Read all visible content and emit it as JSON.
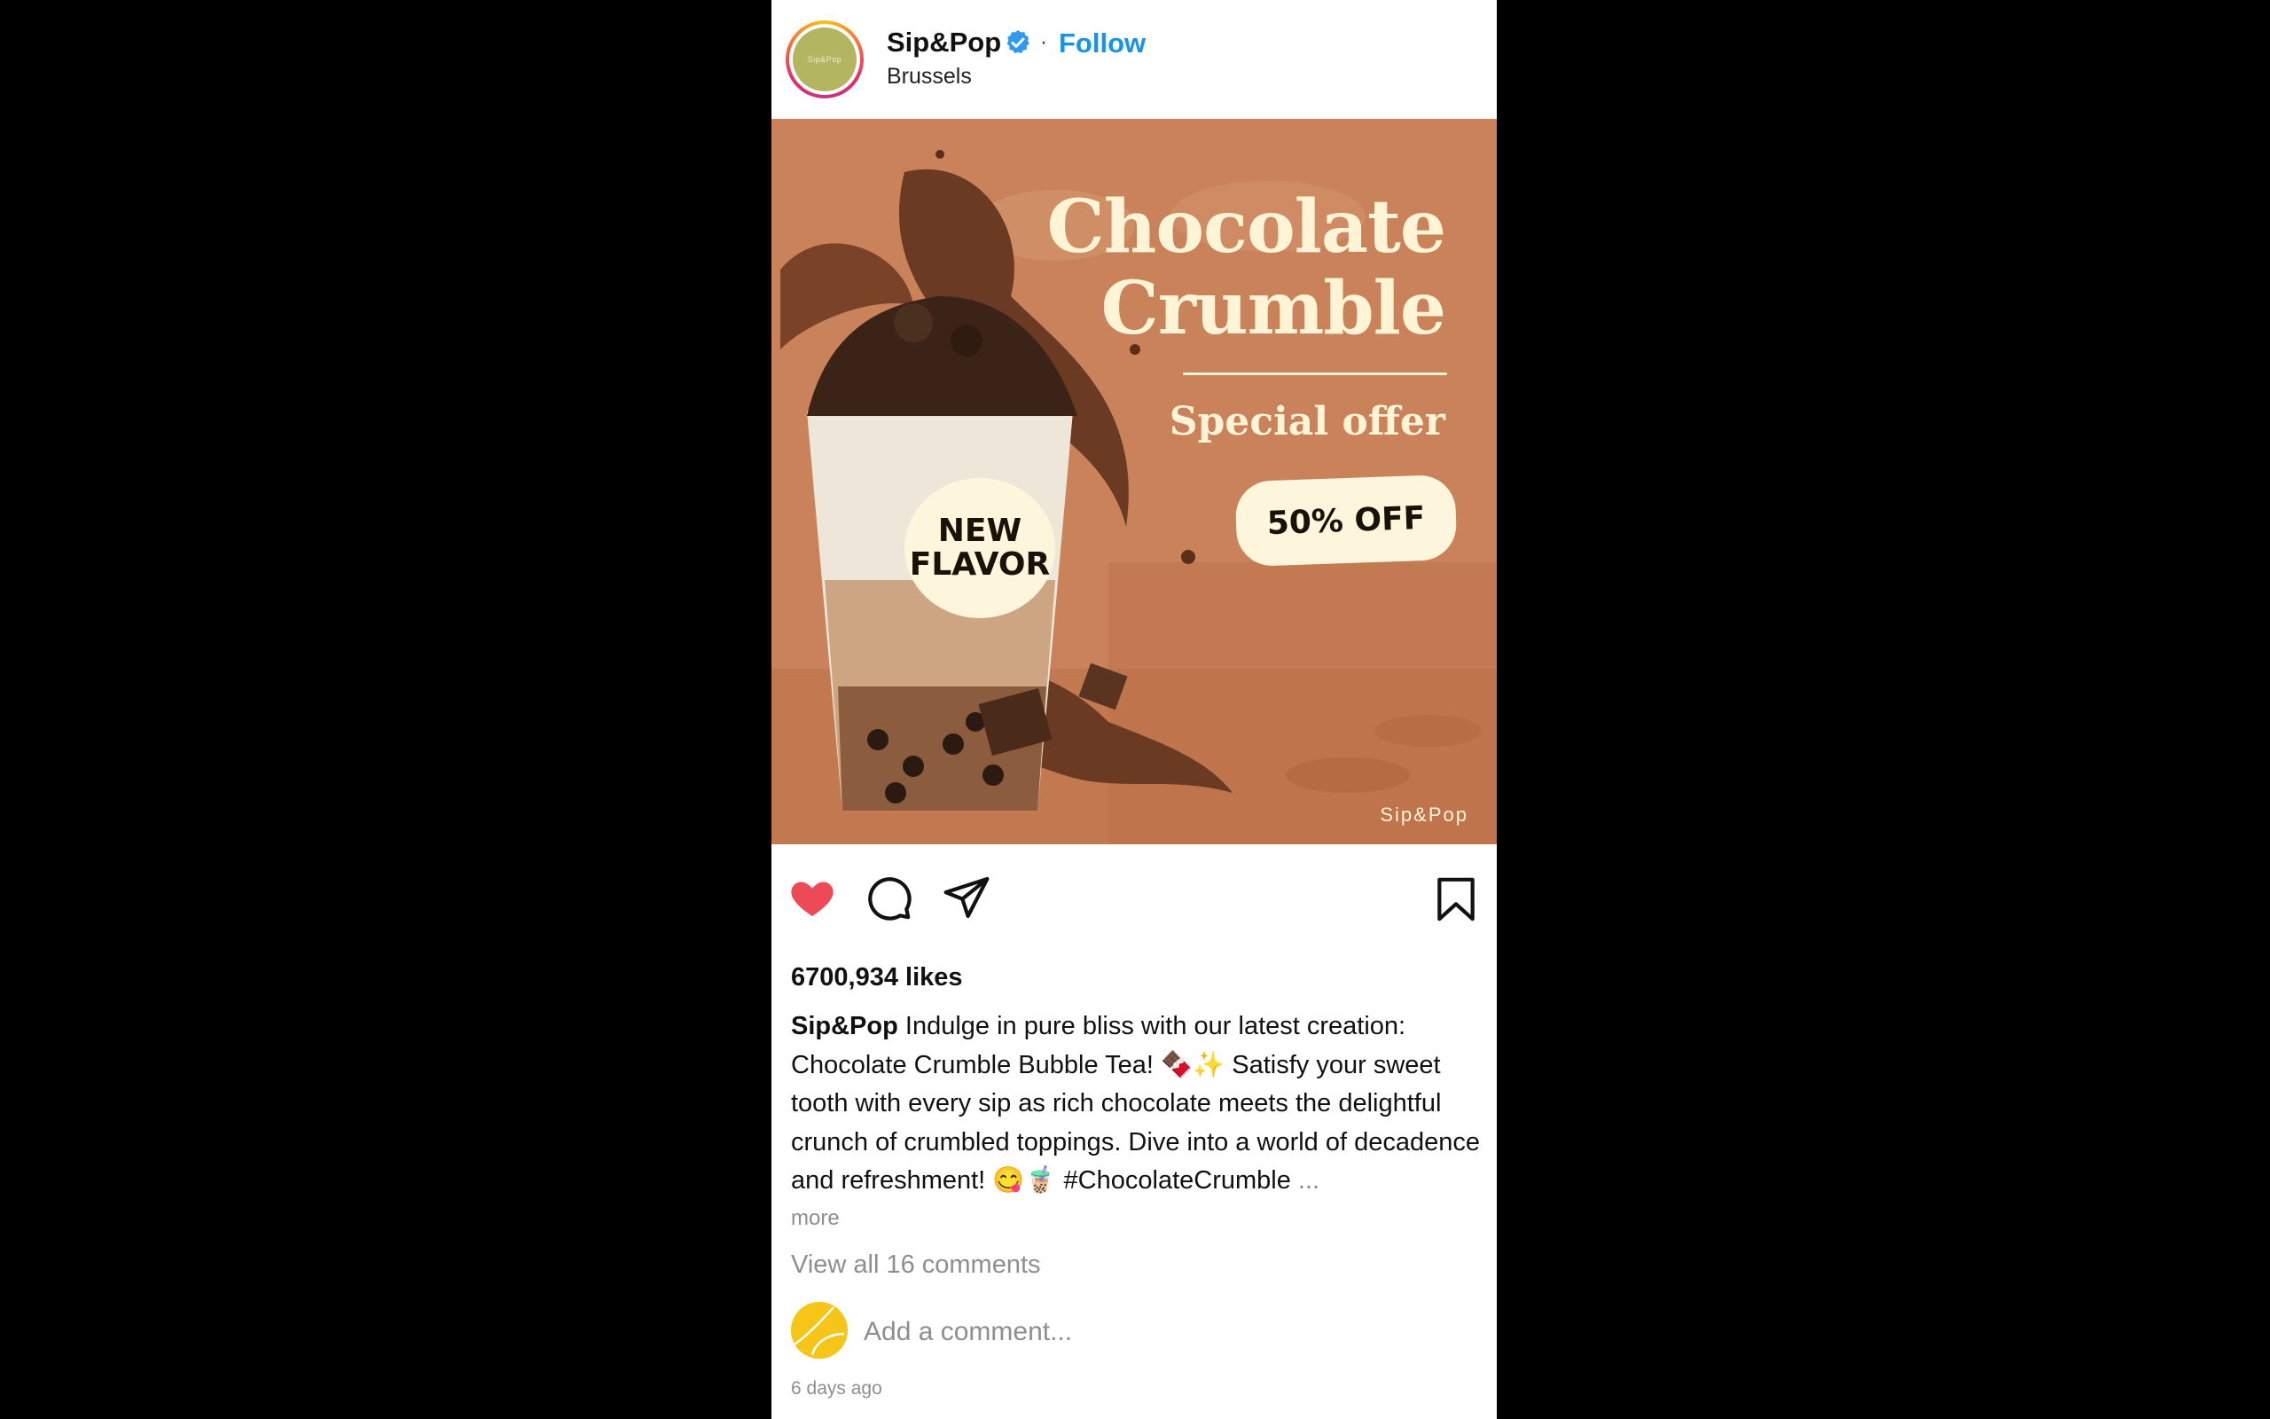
{
  "post": {
    "account": {
      "username": "Sip&Pop",
      "avatar_text": "Sip&Pop",
      "verified_icon": "verified-badge-icon",
      "separator": "·",
      "follow_label": "Follow",
      "location": "Brussels"
    },
    "image": {
      "title": "Chocolate Crumble",
      "subtitle": "Special offer",
      "discount": "50% OFF",
      "badge": "NEW\nFLAVOR",
      "watermark": "Sip&Pop"
    },
    "actions": {
      "like_icon": "heart-filled-icon",
      "comment_icon": "comment-bubble-icon",
      "share_icon": "paper-plane-icon",
      "bookmark_icon": "bookmark-icon",
      "liked": true
    },
    "likes_text": "6700,934 likes",
    "caption": {
      "username": "Sip&Pop",
      "text": "Indulge in pure bliss with our latest creation: Chocolate Crumble Bubble Tea! 🍫✨ Satisfy your sweet tooth with every sip as rich chocolate meets the delightful crunch of crumbled toppings. Dive into a world of decadence and refreshment! 😋🧋 #ChocolateCrumble",
      "ellipsis": "...",
      "more_label": "more"
    },
    "view_comments_label": "View all 16 comments",
    "comment_placeholder": "Add a comment...",
    "timestamp": "6 days ago"
  },
  "colors": {
    "follow": "#1a93e6",
    "like": "#ed4956",
    "hero_background": "#c77a4f",
    "hero_text": "#fff4d6",
    "badge_fill": "#fdf6dc"
  }
}
